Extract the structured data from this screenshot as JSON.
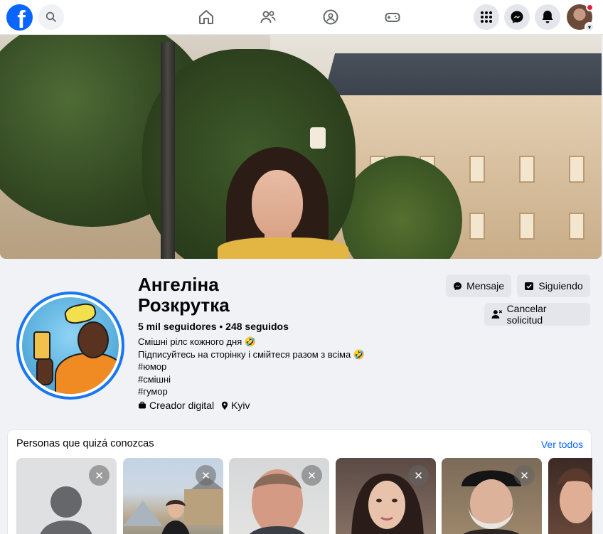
{
  "topbar": {
    "logo": "f",
    "icons": [
      "search-icon",
      "home-icon",
      "friends-icon",
      "groups-icon",
      "gaming-icon",
      "menu-icon",
      "messenger-icon",
      "bell-icon"
    ]
  },
  "profile": {
    "name_line1": "Ангеліна",
    "name_line2": "Розкрутка",
    "followers": "5 mil seguidores",
    "separator": " • ",
    "following": "248 seguidos",
    "bio": [
      "Смішні рілс кожного дня 🤣",
      "Підписуйтесь на сторінку і смійтеся разом з всіма 🤣",
      "#юмор",
      "#смішні",
      "#гумор"
    ],
    "category": "Creador digital",
    "location": "Kyiv"
  },
  "actions": {
    "message": "Mensaje",
    "following": "Siguiendo",
    "cancel_request": "Cancelar solicitud"
  },
  "pymk": {
    "title": "Personas que quizá conozcas",
    "see_all": "Ver todos",
    "close_glyph": "✕"
  },
  "colors": {
    "brand": "#0866ff",
    "button_bg": "#e4e6eb",
    "page_bg": "#f0f2f5",
    "notification": "#e41e3f"
  }
}
